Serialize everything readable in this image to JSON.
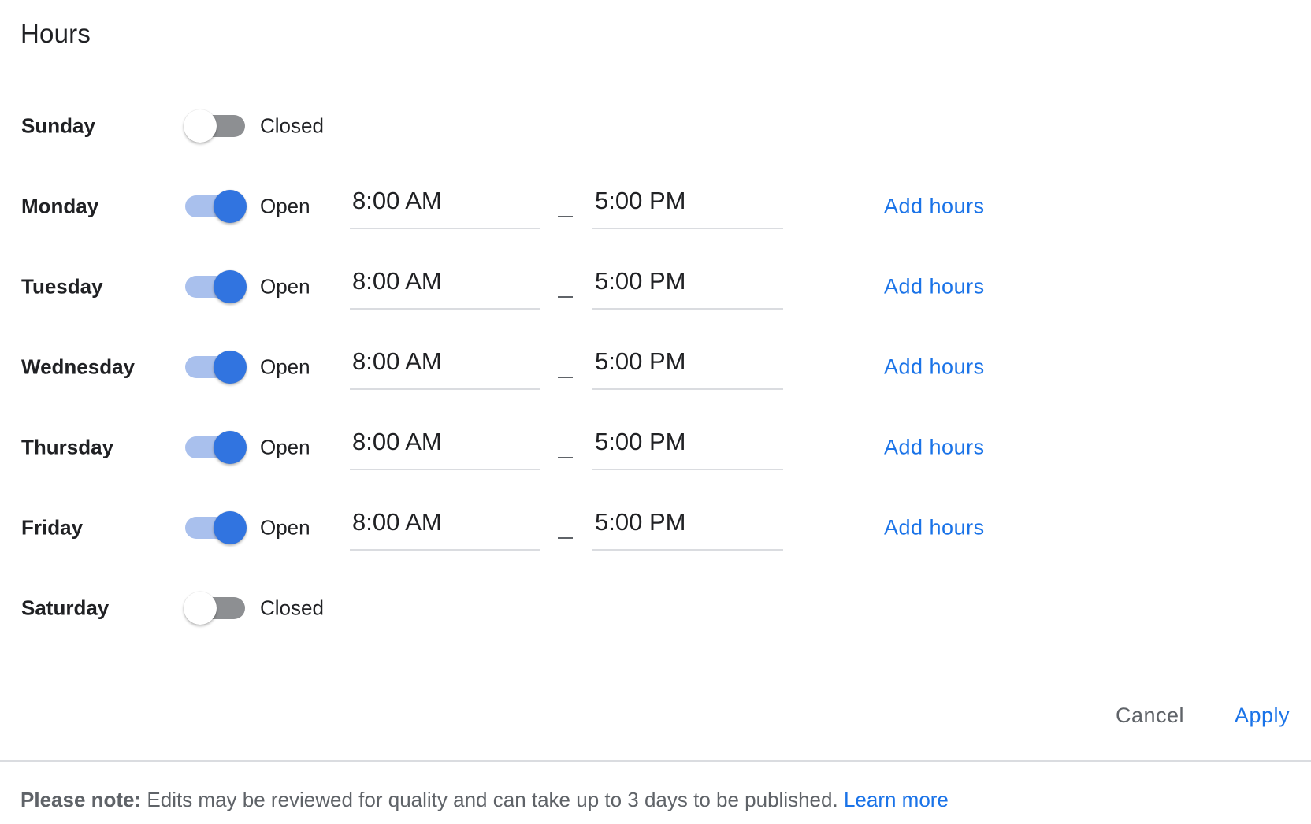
{
  "title": "Hours",
  "days": [
    {
      "name": "Sunday",
      "is_open": false,
      "state_label": "Closed"
    },
    {
      "name": "Monday",
      "is_open": true,
      "state_label": "Open",
      "open_time": "8:00 AM",
      "close_time": "5:00 PM",
      "add_label": "Add hours"
    },
    {
      "name": "Tuesday",
      "is_open": true,
      "state_label": "Open",
      "open_time": "8:00 AM",
      "close_time": "5:00 PM",
      "add_label": "Add hours"
    },
    {
      "name": "Wednesday",
      "is_open": true,
      "state_label": "Open",
      "open_time": "8:00 AM",
      "close_time": "5:00 PM",
      "add_label": "Add hours"
    },
    {
      "name": "Thursday",
      "is_open": true,
      "state_label": "Open",
      "open_time": "8:00 AM",
      "close_time": "5:00 PM",
      "add_label": "Add hours"
    },
    {
      "name": "Friday",
      "is_open": true,
      "state_label": "Open",
      "open_time": "8:00 AM",
      "close_time": "5:00 PM",
      "add_label": "Add hours"
    },
    {
      "name": "Saturday",
      "is_open": false,
      "state_label": "Closed"
    }
  ],
  "actions": {
    "cancel_label": "Cancel",
    "apply_label": "Apply"
  },
  "note": {
    "prefix": "Please note:",
    "text": " Edits may be reviewed for quality and can take up to 3 days to be published. ",
    "link_label": "Learn more"
  },
  "colors": {
    "accent": "#1a73e8",
    "toggle_on_knob": "#3174e0",
    "toggle_on_track": "#a9c0ed",
    "toggle_off_track": "#8d8f92"
  }
}
